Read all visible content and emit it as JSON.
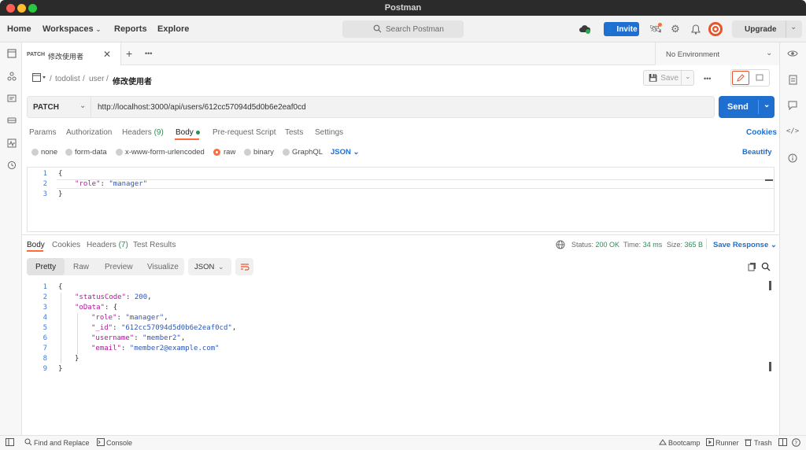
{
  "window": {
    "title": "Postman"
  },
  "nav": {
    "home": "Home",
    "workspaces": "Workspaces",
    "reports": "Reports",
    "explore": "Explore"
  },
  "search": {
    "placeholder": "Search Postman"
  },
  "header": {
    "invite": "Invite",
    "upgrade": "Upgrade"
  },
  "tab": {
    "method": "PATCH",
    "name": "修改使用者"
  },
  "environment": {
    "label": "No Environment"
  },
  "breadcrumb": {
    "collection": "todolist",
    "sep1": "/",
    "folder": "user",
    "sep2": "/",
    "request": "修改使用者"
  },
  "toolbar": {
    "save": "Save",
    "more": "•••"
  },
  "request": {
    "method": "PATCH",
    "url": "http://localhost:3000/api/users/612cc57094d5d0b6e2eaf0cd",
    "send": "Send",
    "tabs": [
      "Params",
      "Authorization",
      "Headers",
      "(9)",
      "Body",
      "Pre-request Script",
      "Tests",
      "Settings"
    ],
    "cookies": "Cookies",
    "body_types": [
      "none",
      "form-data",
      "x-www-form-urlencoded",
      "raw",
      "binary",
      "GraphQL"
    ],
    "format": "JSON",
    "beautify": "Beautify",
    "body_lines": [
      "1",
      "2",
      "3"
    ],
    "body_code": {
      "l1": "{",
      "l2_key": "\"role\"",
      "l2_colon": ": ",
      "l2_val": "\"manager\"",
      "l3": "}"
    }
  },
  "response": {
    "tabs": [
      "Body",
      "Cookies",
      "Headers",
      "(7)",
      "Test Results"
    ],
    "status_label": "Status:",
    "status_value": "200 OK",
    "time_label": "Time:",
    "time_value": "34 ms",
    "size_label": "Size:",
    "size_value": "365 B",
    "save_response": "Save Response",
    "views": [
      "Pretty",
      "Raw",
      "Preview",
      "Visualize"
    ],
    "format": "JSON",
    "lines": [
      "1",
      "2",
      "3",
      "4",
      "5",
      "6",
      "7",
      "8",
      "9"
    ],
    "code": {
      "l1": "{",
      "l2_key": "\"statusCode\"",
      "l2_val": "200",
      "l3_key": "\"oData\"",
      "l3_rest": ": {",
      "l4_key": "\"role\"",
      "l4_val": "\"manager\"",
      "l5_key": "\"_id\"",
      "l5_val": "\"612cc57094d5d0b6e2eaf0cd\"",
      "l6_key": "\"username\"",
      "l6_val": "\"member2\"",
      "l7_key": "\"email\"",
      "l7_val": "\"member2@example.com\"",
      "l8": "}",
      "l9": "}"
    }
  },
  "statusbar": {
    "find_replace": "Find and Replace",
    "console": "Console",
    "bootcamp": "Bootcamp",
    "runner": "Runner",
    "trash": "Trash"
  },
  "colors": {
    "accent": "#1f6fd0",
    "tab_underline": "#ff6c37",
    "status_ok": "#2e8b57"
  }
}
